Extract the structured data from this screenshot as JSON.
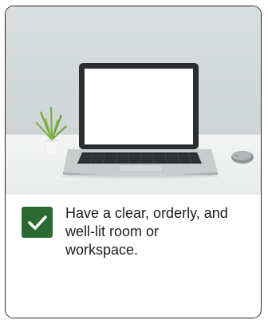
{
  "card": {
    "image_alt": "Laptop on a desk",
    "item": {
      "checked": true,
      "text": "Have a clear, orderly, and well-lit room or workspace."
    }
  },
  "icons": {
    "check": "check-icon"
  },
  "colors": {
    "check_bg": "#2d6a31",
    "card_border": "#2b2b2b",
    "text": "#1c1c1c"
  }
}
